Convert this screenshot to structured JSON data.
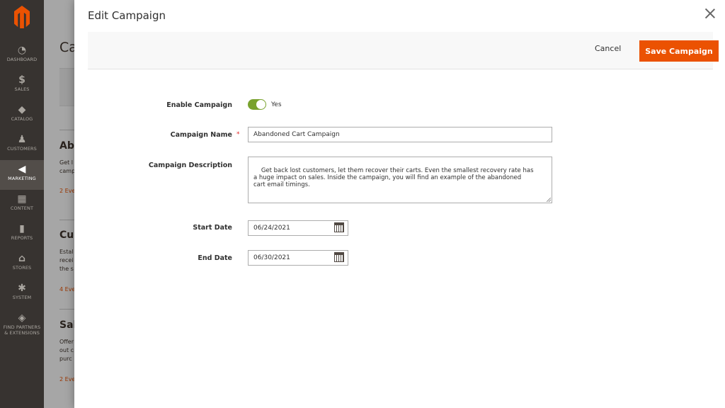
{
  "sidebar": {
    "items": [
      {
        "label": "DASHBOARD",
        "icon": "dashboard-icon",
        "glyph": "◔"
      },
      {
        "label": "SALES",
        "icon": "dollar-icon",
        "glyph": "$"
      },
      {
        "label": "CATALOG",
        "icon": "box-icon",
        "glyph": "◆"
      },
      {
        "label": "CUSTOMERS",
        "icon": "person-icon",
        "glyph": "♟"
      },
      {
        "label": "MARKETING",
        "icon": "megaphone-icon",
        "glyph": "◀"
      },
      {
        "label": "CONTENT",
        "icon": "layout-icon",
        "glyph": "▦"
      },
      {
        "label": "REPORTS",
        "icon": "bar-chart-icon",
        "glyph": "▮"
      },
      {
        "label": "STORES",
        "icon": "store-icon",
        "glyph": "⌂"
      },
      {
        "label": "SYSTEM",
        "icon": "gear-icon",
        "glyph": "✱"
      },
      {
        "label1": "FIND PARTNERS",
        "label2": "& EXTENSIONS",
        "icon": "partners-box-icon",
        "glyph": "◈"
      }
    ]
  },
  "background": {
    "title": "Ca",
    "sections": [
      {
        "heading": "Ab",
        "text": "Get l\ncamp",
        "link": "2 Eve"
      },
      {
        "heading": "Cu",
        "text": "Estal\nrecei\nthe s",
        "link": "4 Eve"
      },
      {
        "heading": "Sal",
        "text": "Offer\nout c\npurc",
        "link": "2 Eve"
      }
    ]
  },
  "modal": {
    "title": "Edit Campaign",
    "cancel_label": "Cancel",
    "save_label": "Save Campaign",
    "fields": {
      "enable_label": "Enable Campaign",
      "enable_value": "Yes",
      "name_label": "Campaign Name",
      "name_value": "Abandoned Cart Campaign",
      "required_mark": "*",
      "description_label": "Campaign Description",
      "description_value": "Get back lost customers, let them recover their carts. Even the smallest recovery rate has\na huge impact on sales. Inside the campaign, you will find an example of the abandoned\ncart email timings.",
      "start_label": "Start Date",
      "start_value": "06/24/2021",
      "end_label": "End Date",
      "end_value": "06/30/2021"
    }
  },
  "colors": {
    "accent": "#eb5202",
    "toggle_on": "#79a22e",
    "sidebar_bg": "#373330"
  }
}
